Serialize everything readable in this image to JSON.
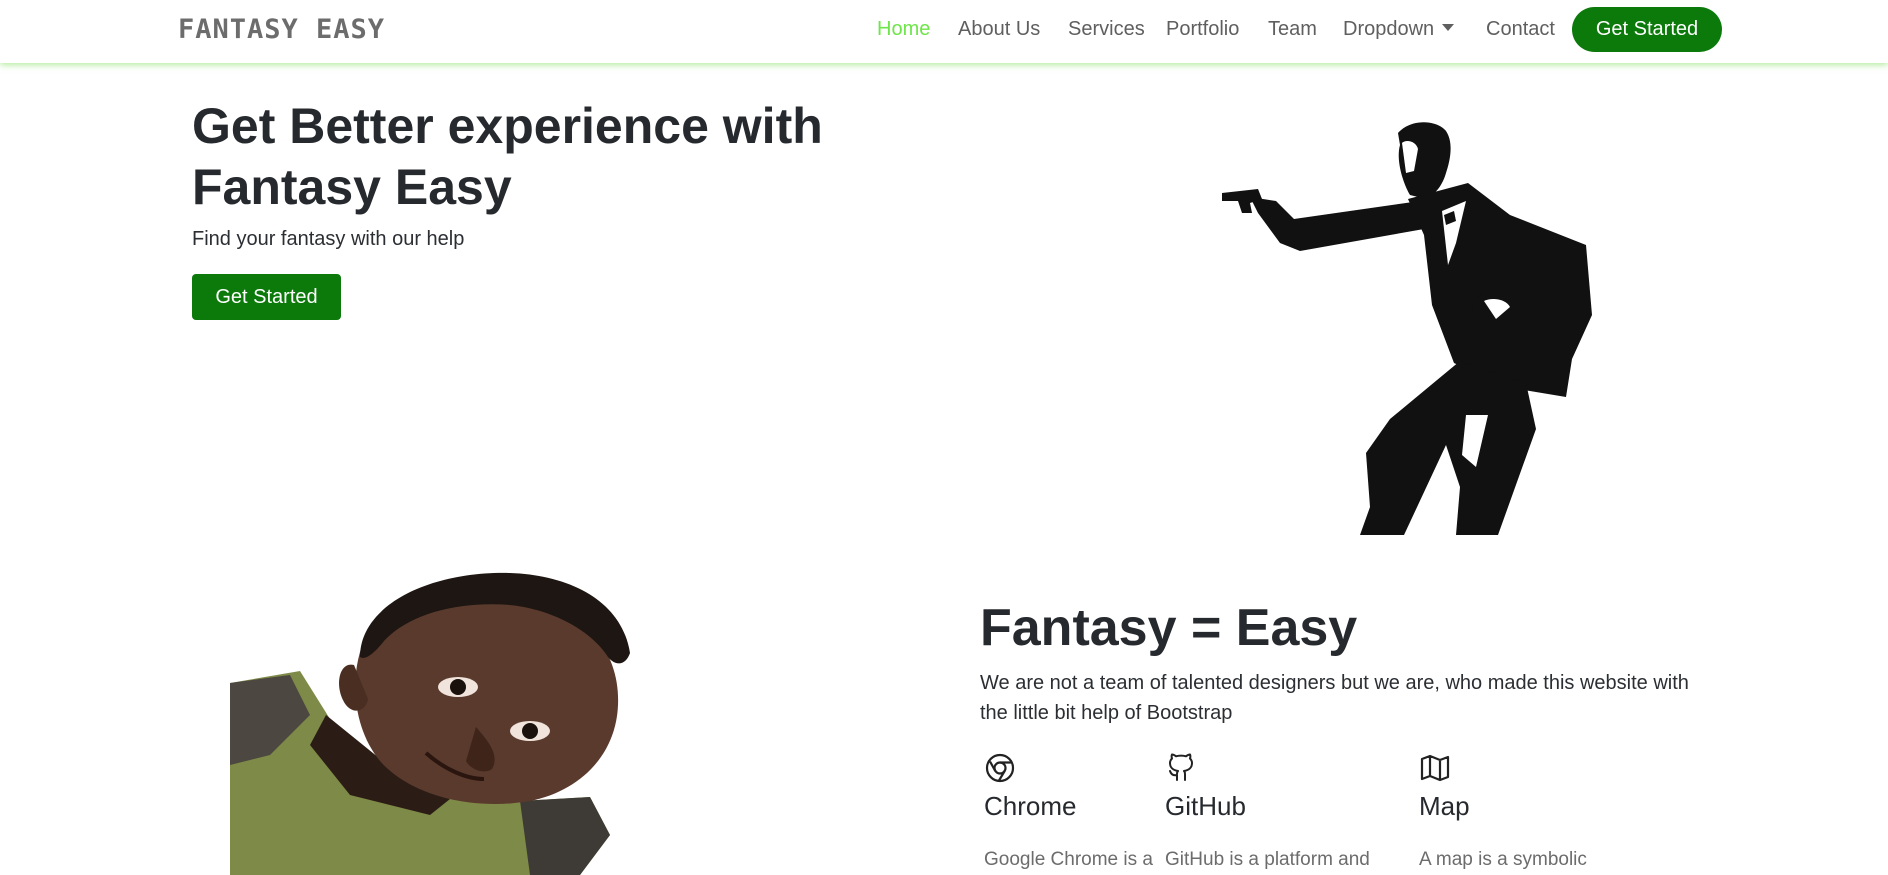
{
  "header": {
    "logo": "FANTASY EASY",
    "nav": [
      {
        "label": "Home",
        "active": true
      },
      {
        "label": "About Us"
      },
      {
        "label": "Services"
      },
      {
        "label": "Portfolio"
      },
      {
        "label": "Team"
      },
      {
        "label": "Dropdown"
      },
      {
        "label": "Contact"
      }
    ],
    "cta": "Get Started"
  },
  "hero": {
    "title": "Get Better experience with Fantasy Easy",
    "subtitle": "Find your fantasy with our help",
    "button": "Get Started",
    "image": "silhouette-gunman-illustration"
  },
  "about": {
    "image": "smiling-man-photo",
    "title": "Fantasy = Easy",
    "text": "We are not a team of talented designers but we are, who made this website with the little bit help of Bootstrap",
    "features": [
      {
        "icon": "chrome-icon",
        "title": "Chrome",
        "text": "Google Chrome is a"
      },
      {
        "icon": "github-icon",
        "title": "GitHub",
        "text": "GitHub is a platform and"
      },
      {
        "icon": "map-icon",
        "title": "Map",
        "text": "A map is a symbolic depiction"
      }
    ]
  },
  "colors": {
    "brand_green": "#0b7a0b",
    "active_nav": "#6ee54a",
    "nav_shadow": "#78dc50"
  }
}
